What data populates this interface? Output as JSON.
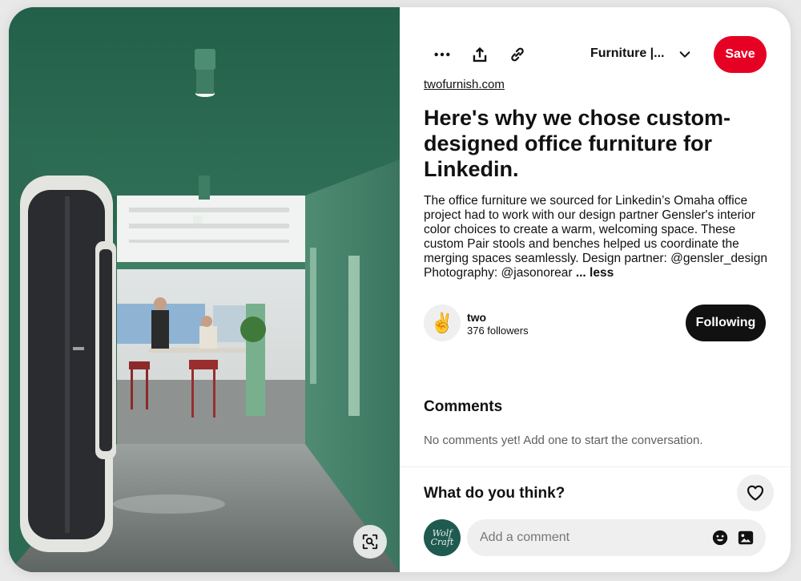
{
  "pin": {
    "image_alt": "Green-walled office corridor with phone booths opening onto an open workspace",
    "domain_link": "twofurnish.com",
    "title": "Here's why we chose custom-designed office furniture for Linkedin.",
    "description": "The office furniture we sourced for Linkedin’s Omaha office project had to work with our design partner Gensler's interior color choices to create a warm, welcoming space. These custom Pair stools and benches helped us coordinate the merging spaces seamlessly. Design partner: @gensler_design Photography: @jasonorear",
    "less_label": "... less"
  },
  "toolbar": {
    "board_name": "Furniture |...",
    "save_label": "Save",
    "more_icon": "more-icon",
    "share_icon": "share-icon",
    "link_icon": "link-icon",
    "chevron_icon": "chevron-down-icon"
  },
  "creator": {
    "name": "two",
    "followers": "376 followers",
    "avatar_glyph": "✌",
    "following_label": "Following"
  },
  "comments": {
    "heading": "Comments",
    "empty_text": "No comments yet! Add one to start the conversation."
  },
  "composer": {
    "prompt": "What do you think?",
    "avatar_text": "Wolf Craft",
    "placeholder": "Add a comment",
    "emoji_icon": "emoji-icon",
    "image_icon": "image-icon",
    "heart_icon": "heart-icon"
  },
  "colors": {
    "save_red": "#e60023",
    "following_black": "#111111",
    "wall_green": "#3d7a62"
  }
}
